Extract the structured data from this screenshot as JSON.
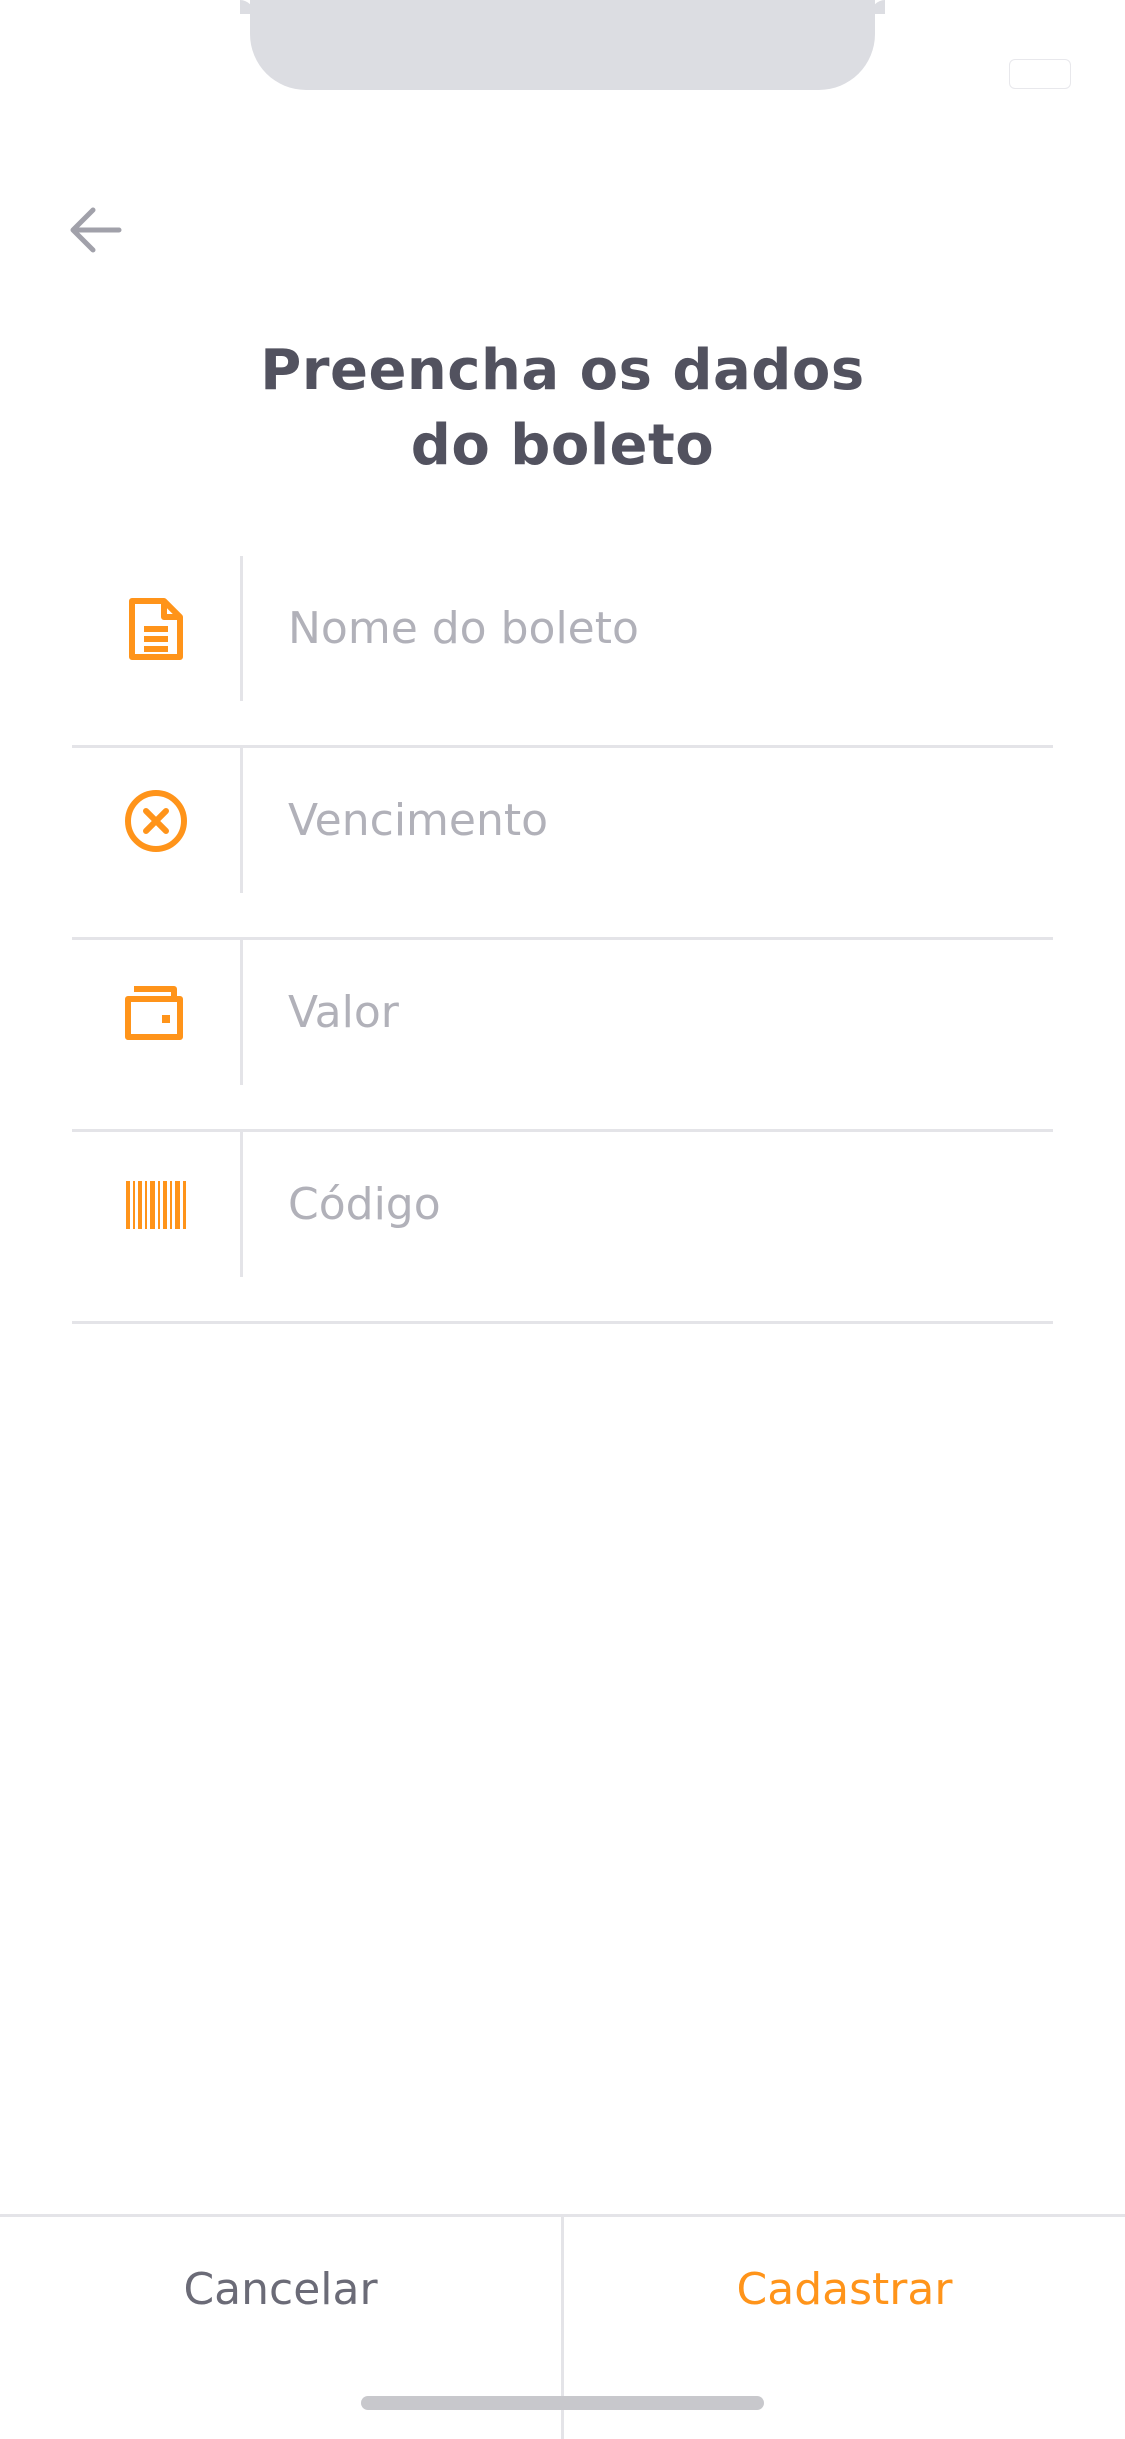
{
  "header": {
    "back_icon": "arrow-left-icon",
    "title_line1": "Preencha os dados",
    "title_line2": "do boleto"
  },
  "form": {
    "fields": [
      {
        "icon": "file-text-icon",
        "placeholder": "Nome do boleto",
        "value": ""
      },
      {
        "icon": "x-circle-icon",
        "placeholder": "Vencimento",
        "value": ""
      },
      {
        "icon": "wallet-icon",
        "placeholder": "Valor",
        "value": ""
      },
      {
        "icon": "barcode-icon",
        "placeholder": "Código",
        "value": ""
      }
    ]
  },
  "footer": {
    "cancel_label": "Cancelar",
    "register_label": "Cadastrar"
  },
  "colors": {
    "accent": "#ff941a",
    "heading": "#52525f",
    "placeholder": "#b1b1b9",
    "divider": "#e4e4e8",
    "muted": "#6b6b77"
  }
}
